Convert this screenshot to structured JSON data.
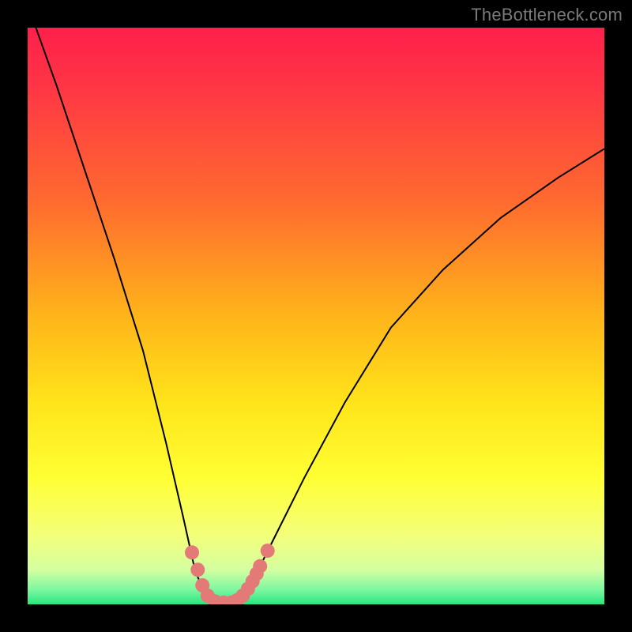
{
  "attribution": "TheBottleneck.com",
  "chart_data": {
    "type": "line",
    "title": "",
    "xlabel": "",
    "ylabel": "",
    "xlim": [
      0,
      100
    ],
    "ylim": [
      0,
      100
    ],
    "green_band_y": [
      0,
      6
    ],
    "curve": [
      {
        "x": 0,
        "y": 104
      },
      {
        "x": 5,
        "y": 90
      },
      {
        "x": 10,
        "y": 75
      },
      {
        "x": 15,
        "y": 60
      },
      {
        "x": 20,
        "y": 44
      },
      {
        "x": 24,
        "y": 28
      },
      {
        "x": 27,
        "y": 15
      },
      {
        "x": 29,
        "y": 6
      },
      {
        "x": 31,
        "y": 1
      },
      {
        "x": 33,
        "y": 0
      },
      {
        "x": 35,
        "y": 0
      },
      {
        "x": 37,
        "y": 1
      },
      {
        "x": 39,
        "y": 4
      },
      {
        "x": 42,
        "y": 10
      },
      {
        "x": 48,
        "y": 22
      },
      {
        "x": 55,
        "y": 35
      },
      {
        "x": 63,
        "y": 48
      },
      {
        "x": 72,
        "y": 58
      },
      {
        "x": 82,
        "y": 67
      },
      {
        "x": 92,
        "y": 74
      },
      {
        "x": 100,
        "y": 79
      }
    ],
    "markers": [
      {
        "x": 28.5,
        "y": 9
      },
      {
        "x": 29.5,
        "y": 6
      },
      {
        "x": 30.3,
        "y": 3.3
      },
      {
        "x": 31.2,
        "y": 1.5
      },
      {
        "x": 32.5,
        "y": 0.5
      },
      {
        "x": 34.0,
        "y": 0.3
      },
      {
        "x": 35.3,
        "y": 0.3
      },
      {
        "x": 36.3,
        "y": 0.7
      },
      {
        "x": 37.3,
        "y": 1.5
      },
      {
        "x": 38.2,
        "y": 2.7
      },
      {
        "x": 39.0,
        "y": 4.0
      },
      {
        "x": 39.7,
        "y": 5.3
      },
      {
        "x": 40.3,
        "y": 6.6
      },
      {
        "x": 41.6,
        "y": 9.3
      }
    ],
    "gradient_stops": [
      {
        "offset": 0.0,
        "color": "#ff1f4b"
      },
      {
        "offset": 0.1,
        "color": "#ff3545"
      },
      {
        "offset": 0.3,
        "color": "#ff6a2f"
      },
      {
        "offset": 0.5,
        "color": "#ffb41a"
      },
      {
        "offset": 0.65,
        "color": "#ffe41a"
      },
      {
        "offset": 0.78,
        "color": "#ffff33"
      },
      {
        "offset": 0.88,
        "color": "#f4ff7a"
      },
      {
        "offset": 0.94,
        "color": "#d4ffa0"
      },
      {
        "offset": 0.975,
        "color": "#7cf7a0"
      },
      {
        "offset": 1.0,
        "color": "#28e67f"
      }
    ],
    "marker_color": "#e47a78",
    "curve_color": "#000000"
  }
}
